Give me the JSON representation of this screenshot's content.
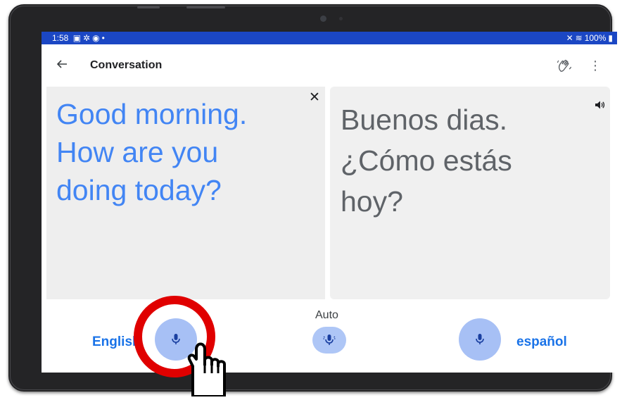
{
  "status_bar": {
    "time": "1:58",
    "left_icons": [
      "image-icon",
      "gear-icon",
      "circle-icon",
      "dot-icon"
    ],
    "right_icons": [
      "mute-icon",
      "wifi-icon"
    ],
    "battery": "100%"
  },
  "app_bar": {
    "title": "Conversation",
    "back_icon": "arrow-left-icon",
    "hand_icon": "waving-hand-icon",
    "menu_icon": "more-vert-icon"
  },
  "panels": {
    "source": {
      "lines": [
        "Good morning.",
        "How are you",
        "doing today?"
      ],
      "close_icon": "close-icon",
      "color": "#4285f4"
    },
    "target": {
      "lines": [
        "Buenos dias.",
        "¿Cómo estás",
        "hoy?"
      ],
      "speaker_icon": "volume-icon",
      "color": "#5f6368"
    }
  },
  "bottom_bar": {
    "left_language": "English",
    "auto_label": "Auto",
    "right_language": "español",
    "mic_color": "#a7c0f5",
    "accent": "#1a73e8"
  },
  "overlay": {
    "highlight_color": "#e00000",
    "pointer_icon": "hand-pointer-icon"
  }
}
